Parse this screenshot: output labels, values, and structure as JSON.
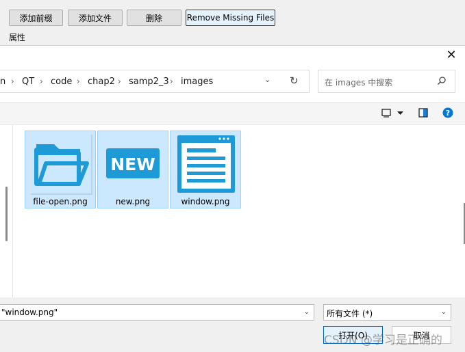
{
  "app": {
    "buttons": [
      "添加前缀",
      "添加文件",
      "删除",
      "Remove Missing Files"
    ],
    "properties_label": "属性"
  },
  "dialog": {
    "breadcrumb": [
      "n",
      "QT",
      "code",
      "chap2",
      "samp2_3",
      "images"
    ],
    "search_placeholder": "在 images 中搜索",
    "files": [
      {
        "name": "file-open.png",
        "icon": "folder-open-icon"
      },
      {
        "name": "new.png",
        "icon": "new-badge-icon"
      },
      {
        "name": "window.png",
        "icon": "window-doc-icon"
      }
    ],
    "filename_value": "\"window.png\"",
    "filter_value": "所有文件 (*)",
    "open_label": "打开(O)",
    "cancel_label": "取消",
    "new_badge_text": "NEW"
  },
  "watermark": "CSDN @学习是正确的",
  "colors": {
    "selection": "#cce8ff",
    "accent_blue": "#1e9ad6",
    "help_icon": "#0078d4"
  }
}
